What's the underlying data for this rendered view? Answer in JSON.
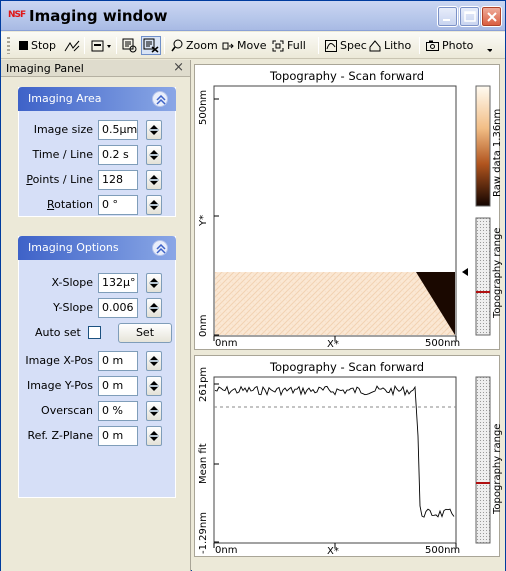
{
  "window": {
    "title": "Imaging window",
    "logo_text": "NSF",
    "accent_color": "#0a246a",
    "titlebar_color": "#b6c6ea"
  },
  "toolbar": {
    "items": [
      {
        "label": "Stop",
        "icon": "stop-square-icon"
      },
      {
        "label": "",
        "icon": "slope-icon"
      },
      {
        "label": "",
        "icon": "view-dropdown-icon"
      },
      {
        "label": "",
        "icon": "image-zoom-icon"
      },
      {
        "label": "",
        "icon": "image-select-icon"
      },
      {
        "label": "Zoom",
        "icon": "magnifier-icon"
      },
      {
        "label": "Move",
        "icon": "move-icon"
      },
      {
        "label": "Full",
        "icon": "full-extent-icon"
      },
      {
        "label": "Spec",
        "icon": "spectrum-icon"
      },
      {
        "label": "Litho",
        "icon": "litho-icon"
      },
      {
        "label": "Photo",
        "icon": "camera-icon"
      }
    ]
  },
  "panel": {
    "title": "Imaging Panel",
    "imaging_area": {
      "title": "Imaging Area",
      "fields": [
        {
          "label": "Image size",
          "value": "0.5µm"
        },
        {
          "label": "Time / Line",
          "value": "0.2 s"
        },
        {
          "label": "Points / Line",
          "value": "128"
        },
        {
          "label": "Rotation",
          "value": "0 °"
        }
      ]
    },
    "imaging_options": {
      "title": "Imaging Options",
      "fields": [
        {
          "label": "X-Slope",
          "value": "132µ°"
        },
        {
          "label": "Y-Slope",
          "value": "0.006 °"
        },
        {
          "label": "Image X-Pos",
          "value": "0 m"
        },
        {
          "label": "Image Y-Pos",
          "value": "0 m"
        },
        {
          "label": "Overscan",
          "value": "0 %"
        },
        {
          "label": "Ref. Z-Plane",
          "value": "0 m"
        }
      ],
      "auto_set_label": "Auto set",
      "auto_set_checked": false,
      "set_button": "Set"
    }
  },
  "top_plot": {
    "title": "Topography - Scan forward",
    "y_top": "500nm",
    "y_bottom": "0nm",
    "y_axis": "Y*",
    "x_left": "0nm",
    "x_axis": "X*",
    "x_right": "500nm",
    "colorbar_label": "Raw data 1.36nm",
    "range_label": "Topography range"
  },
  "bottom_plot": {
    "title": "Topography - Scan forward",
    "y_top": "261pm",
    "y_mid": "Mean fit",
    "y_bottom": "-1.29nm",
    "x_left": "0nm",
    "x_axis": "X*",
    "x_right": "500nm",
    "range_label": "Topography range"
  }
}
